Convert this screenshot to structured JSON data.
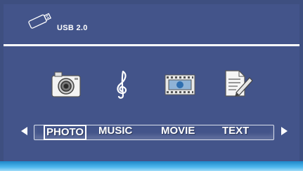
{
  "header": {
    "device_label": "USB 2.0",
    "device_icon": "usb-drive-icon"
  },
  "media_icons": [
    {
      "name": "camera-icon"
    },
    {
      "name": "music-note-icon"
    },
    {
      "name": "film-icon"
    },
    {
      "name": "text-document-icon"
    }
  ],
  "menu": {
    "items": [
      {
        "label": "PHOTO",
        "selected": true
      },
      {
        "label": "MUSIC",
        "selected": false
      },
      {
        "label": "MOVIE",
        "selected": false
      },
      {
        "label": "TEXT",
        "selected": false
      }
    ]
  },
  "colors": {
    "background": "#43548a",
    "accent_bar": "#4fb8ee",
    "text": "#ffffff"
  }
}
